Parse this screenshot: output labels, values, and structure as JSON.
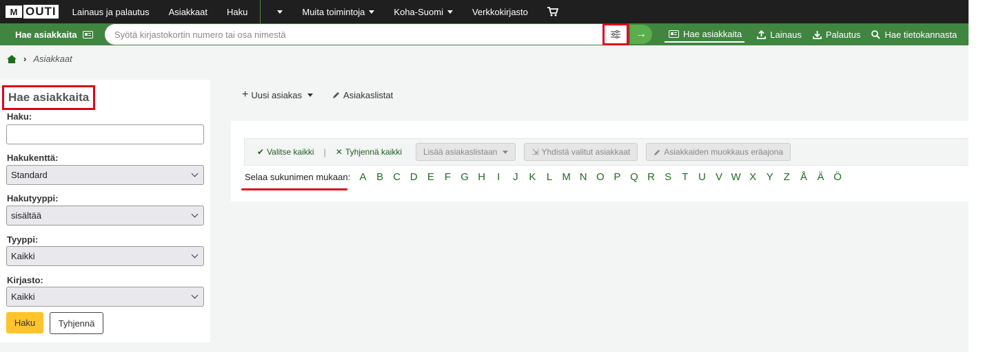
{
  "brand": {
    "logo_mark": "M",
    "logo_text": "OUTI"
  },
  "topnav": {
    "items": [
      "Lainaus ja palautus",
      "Asiakkaat",
      "Haku"
    ],
    "more": "Muita toimintoja",
    "koha": "Koha-Suomi",
    "library": "Verkkokirjasto",
    "cart_icon": "cart-icon"
  },
  "searchbar": {
    "tab_label": "Hae asiakkaita",
    "placeholder": "Syötä kirjastokortin numero tai osa nimestä",
    "go": "→",
    "links": [
      {
        "label": "Hae asiakkaita",
        "icon": "card-icon",
        "active": true
      },
      {
        "label": "Lainaus",
        "icon": "upload-icon"
      },
      {
        "label": "Palautus",
        "icon": "download-icon"
      },
      {
        "label": "Hae tietokannasta",
        "icon": "search-icon"
      }
    ]
  },
  "breadcrumb": {
    "separator": "›",
    "current": "Asiakkaat"
  },
  "sidebar": {
    "title": "Hae asiakkaita",
    "search_label": "Haku:",
    "field_label": "Hakukenttä:",
    "field_value": "Standard",
    "type_label": "Hakutyyppi:",
    "type_value": "sisältää",
    "category_label": "Tyyppi:",
    "category_value": "Kaikki",
    "library_label": "Kirjasto:",
    "library_value": "Kaikki",
    "submit": "Haku",
    "clear": "Tyhjennä"
  },
  "toolbar": {
    "new_patron": "Uusi asiakas",
    "patron_lists": "Asiakaslistat"
  },
  "bulk": {
    "select_all": "Valitse kaikki",
    "clear_all": "Tyhjennä kaikki",
    "add_to_list": "Lisää asiakaslistaan",
    "merge": "Yhdistä valitut asiakkaat",
    "batch_edit": "Asiakkaiden muokkaus eräajona"
  },
  "browse": {
    "label": "Selaa sukunimen mukaan:",
    "letters": [
      "A",
      "B",
      "C",
      "D",
      "E",
      "F",
      "G",
      "H",
      "I",
      "J",
      "K",
      "L",
      "M",
      "N",
      "O",
      "P",
      "Q",
      "R",
      "S",
      "T",
      "U",
      "V",
      "W",
      "X",
      "Y",
      "Z",
      "Å",
      "Ä",
      "Ö"
    ]
  },
  "colors": {
    "accent": "#408540",
    "highlight": "#e0001b",
    "button": "#ffc32b"
  }
}
